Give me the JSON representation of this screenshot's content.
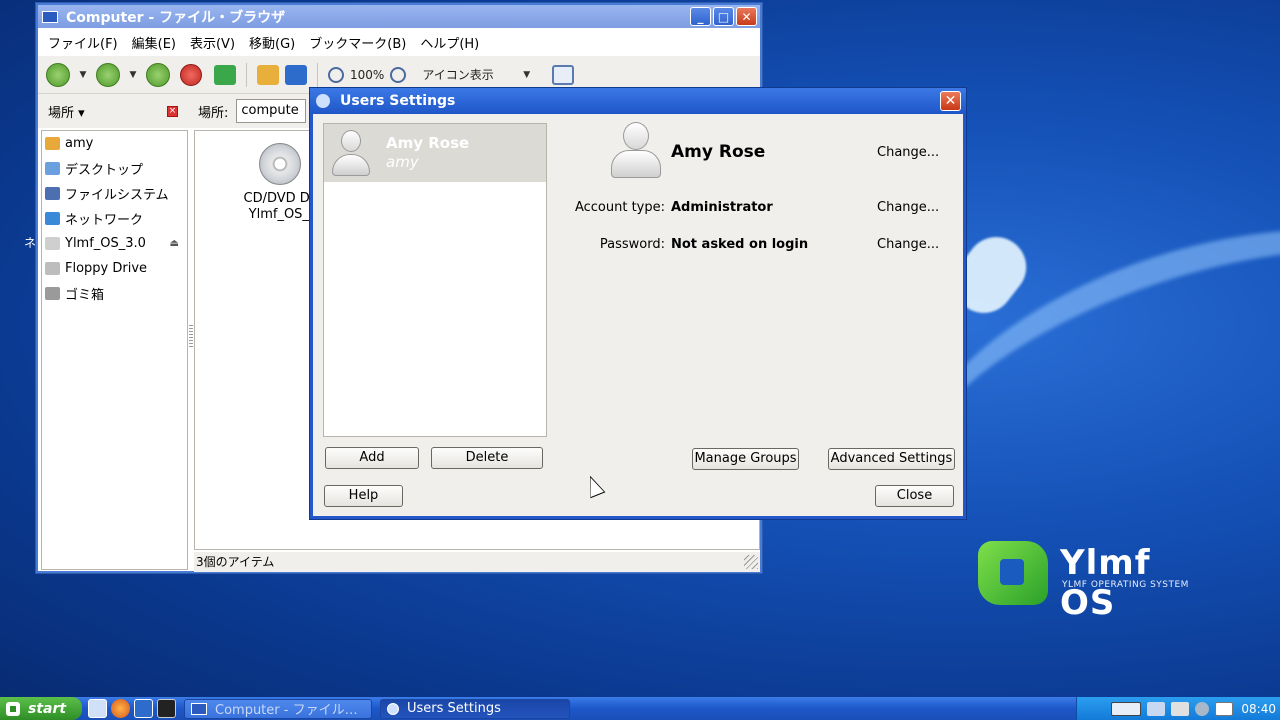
{
  "desktop": {
    "logo": {
      "title": "Ylmf OS",
      "subtitle": "YLMF OPERATING SYSTEM"
    }
  },
  "file_browser": {
    "title": "Computer - ファイル・ブラウザ",
    "menu": [
      "ファイル(F)",
      "編集(E)",
      "表示(V)",
      "移動(G)",
      "ブックマーク(B)",
      "ヘルプ(H)"
    ],
    "toolbar": {
      "zoom": "100%",
      "view_mode": "アイコン表示"
    },
    "sidebar_header": "場所",
    "location_label": "場所:",
    "location_value": "compute",
    "places": [
      {
        "label": "amy",
        "icon": "folder-home-icon",
        "color": "#e8a93a"
      },
      {
        "label": "デスクトップ",
        "icon": "desktop-icon",
        "color": "#6a9fe0"
      },
      {
        "label": "ファイルシステム",
        "icon": "harddisk-icon",
        "color": "#4b6fb0"
      },
      {
        "label": "ネットワーク",
        "icon": "network-icon",
        "color": "#3a88d8"
      },
      {
        "label": "Ylmf_OS_3.0",
        "icon": "cdrom-icon",
        "color": "#cfcfcf"
      },
      {
        "label": "Floppy Drive",
        "icon": "floppy-icon",
        "color": "#bdbdbd"
      },
      {
        "label": "ゴミ箱",
        "icon": "trash-icon",
        "color": "#9a9a9a"
      }
    ],
    "main_item": {
      "line1": "CD/DVD Driv",
      "line2": "Ylmf_OS_3."
    },
    "status": "3個のアイテム",
    "stray_text": "ネ"
  },
  "users_dialog": {
    "title": "Users Settings",
    "user_list": [
      {
        "name": "Amy Rose",
        "login": "amy"
      }
    ],
    "selected_user": {
      "full_name": "Amy Rose",
      "account_type_label": "Account type:",
      "account_type": "Administrator",
      "password_label": "Password:",
      "password": "Not asked on login"
    },
    "change_label": "Change...",
    "buttons": {
      "add": "Add",
      "delete": "Delete",
      "manage_groups": "Manage Groups",
      "advanced_settings": "Advanced Settings",
      "help": "Help",
      "close": "Close"
    }
  },
  "taskbar": {
    "start": "start",
    "tasks": [
      {
        "label": "Computer - ファイル…",
        "active": false
      },
      {
        "label": "Users Settings",
        "active": true
      }
    ],
    "clock": "08:40"
  }
}
